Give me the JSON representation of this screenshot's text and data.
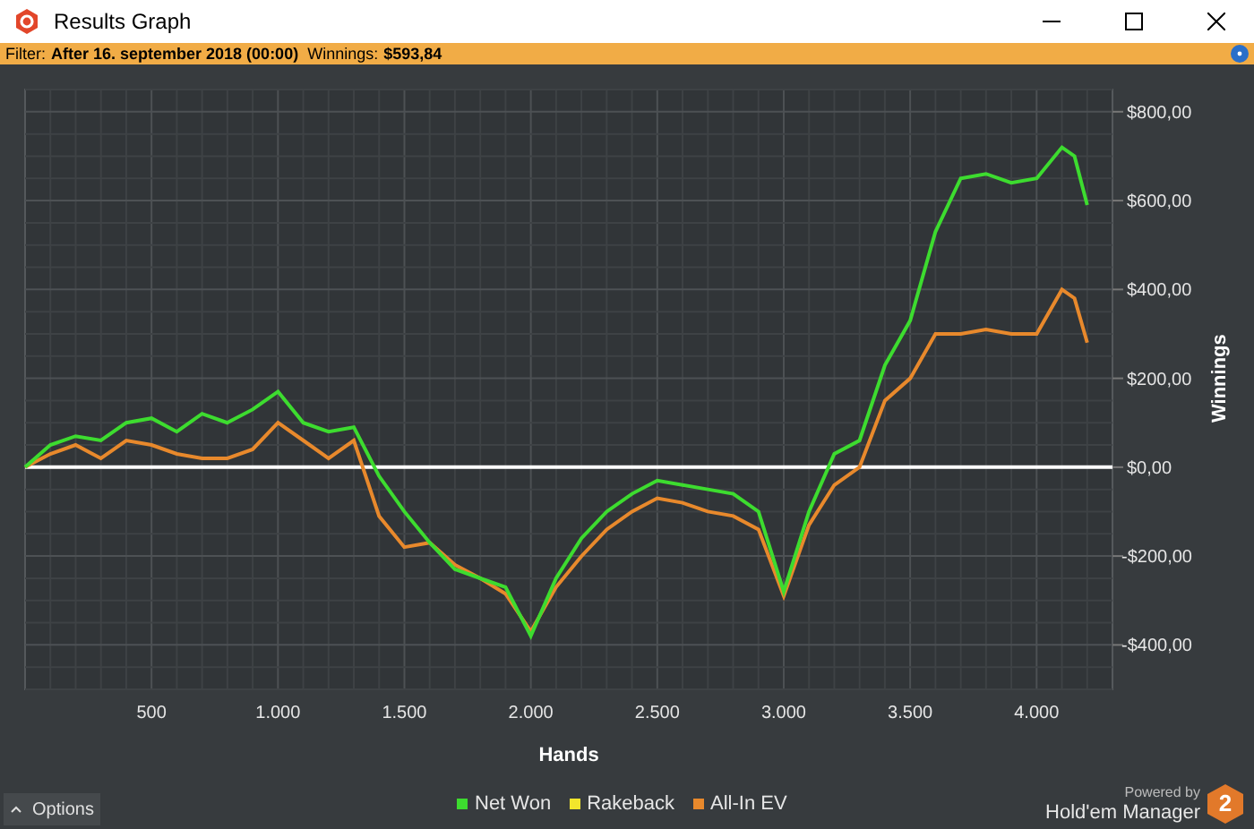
{
  "window": {
    "title": "Results Graph"
  },
  "filter_bar": {
    "filter_label": "Filter:",
    "filter_value": "After 16. september 2018 (00:00)",
    "winnings_label": "Winnings:",
    "winnings_value": "$593,84"
  },
  "chart": {
    "chart_data": {
      "type": "line",
      "xlabel": "Hands",
      "ylabel": "Winnings",
      "x": [
        0,
        100,
        200,
        300,
        400,
        500,
        600,
        700,
        800,
        900,
        1000,
        1100,
        1200,
        1300,
        1400,
        1500,
        1600,
        1700,
        1800,
        1900,
        2000,
        2100,
        2200,
        2300,
        2400,
        2500,
        2600,
        2700,
        2800,
        2900,
        3000,
        3100,
        3200,
        3300,
        3400,
        3500,
        3600,
        3700,
        3800,
        3900,
        4000,
        4100,
        4150,
        4200
      ],
      "series": [
        {
          "name": "Net Won",
          "color": "#3ddc2f",
          "values": [
            0,
            50,
            70,
            60,
            100,
            110,
            80,
            120,
            100,
            130,
            170,
            100,
            80,
            90,
            -20,
            -100,
            -170,
            -230,
            -250,
            -270,
            -380,
            -250,
            -160,
            -100,
            -60,
            -30,
            -40,
            -50,
            -60,
            -100,
            -280,
            -100,
            30,
            60,
            230,
            330,
            530,
            650,
            660,
            640,
            650,
            720,
            700,
            590
          ]
        },
        {
          "name": "Rakeback",
          "color": "#f2e52c",
          "values": [
            null,
            null,
            null,
            null,
            null,
            null,
            null,
            null,
            null,
            null,
            null,
            null,
            null,
            null,
            null,
            null,
            null,
            null,
            null,
            null,
            null,
            null,
            null,
            null,
            null,
            null,
            null,
            null,
            null,
            null,
            null,
            null,
            null,
            null,
            null,
            null,
            null,
            null,
            null,
            null,
            null,
            null,
            null,
            null
          ]
        },
        {
          "name": "All-In EV",
          "color": "#e8892c",
          "values": [
            0,
            30,
            50,
            20,
            60,
            50,
            30,
            20,
            20,
            40,
            100,
            60,
            20,
            60,
            -110,
            -180,
            -170,
            -220,
            -250,
            -285,
            -370,
            -270,
            -200,
            -140,
            -100,
            -70,
            -80,
            -100,
            -110,
            -140,
            -290,
            -130,
            -40,
            0,
            150,
            200,
            300,
            300,
            310,
            300,
            300,
            400,
            380,
            280
          ]
        }
      ],
      "grid": true,
      "xlim": [
        0,
        4300
      ],
      "ylim": [
        -500,
        850
      ],
      "xticks": [
        {
          "value": 500,
          "label": "500"
        },
        {
          "value": 1000,
          "label": "1.000"
        },
        {
          "value": 1500,
          "label": "1.500"
        },
        {
          "value": 2000,
          "label": "2.000"
        },
        {
          "value": 2500,
          "label": "2.500"
        },
        {
          "value": 3000,
          "label": "3.000"
        },
        {
          "value": 3500,
          "label": "3.500"
        },
        {
          "value": 4000,
          "label": "4.000"
        }
      ],
      "yticks": [
        {
          "value": 800,
          "label": "$800,00"
        },
        {
          "value": 600,
          "label": "$600,00"
        },
        {
          "value": 400,
          "label": "$400,00"
        },
        {
          "value": 200,
          "label": "$200,00"
        },
        {
          "value": 0,
          "label": "$0,00"
        },
        {
          "value": -200,
          "label": "-$200,00"
        },
        {
          "value": -400,
          "label": "-$400,00"
        }
      ]
    }
  },
  "options_button": {
    "label": "Options"
  },
  "branding": {
    "powered_by": "Powered by",
    "product": "Hold'em Manager",
    "logo": "2"
  }
}
